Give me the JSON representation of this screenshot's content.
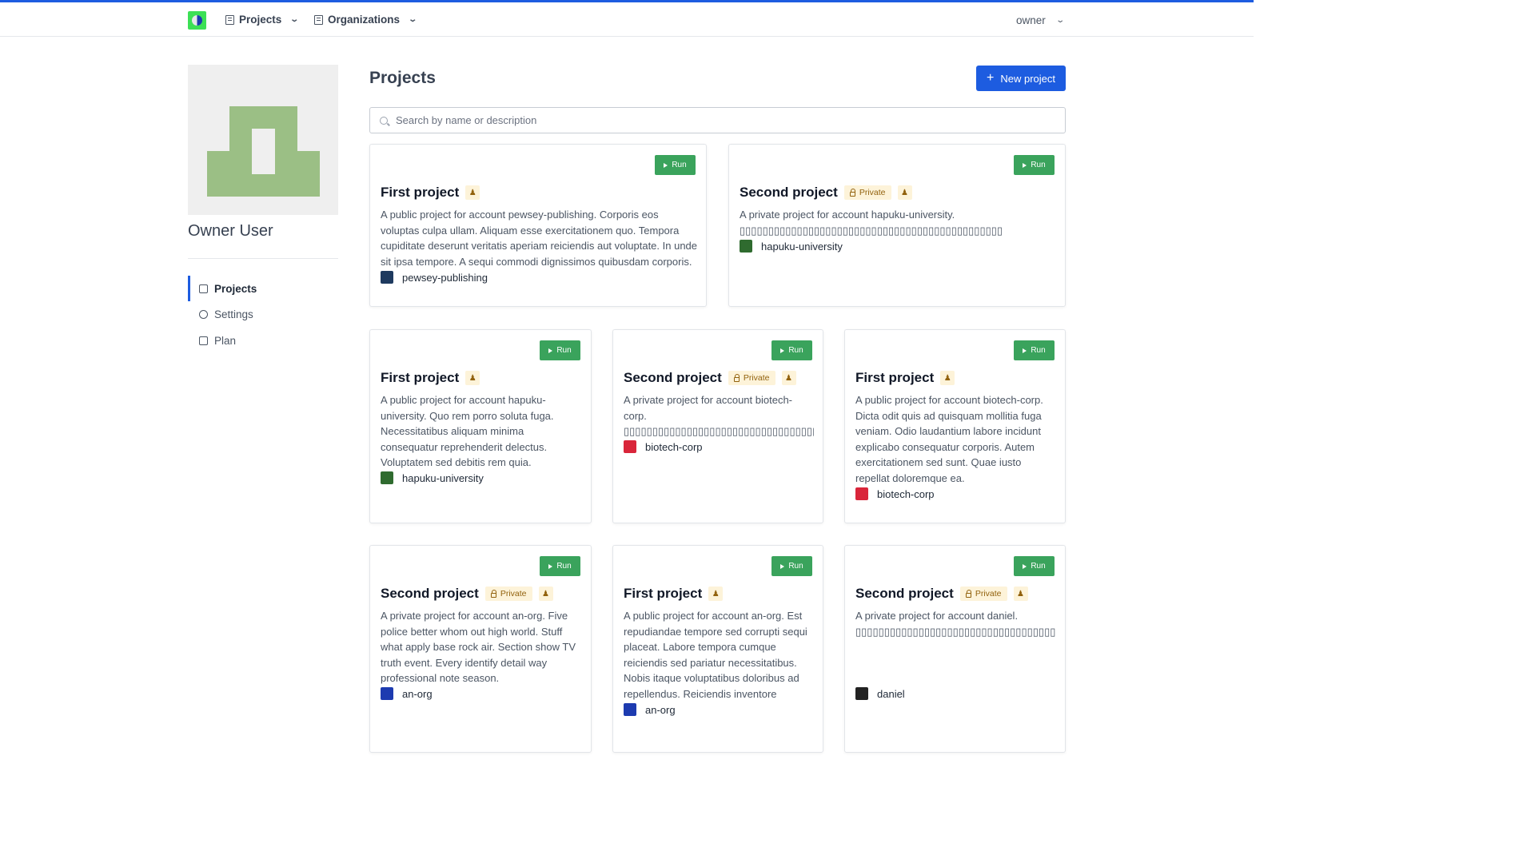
{
  "topbar": {
    "projects_label": "Projects",
    "organizations_label": "Organizations",
    "user_label": "owner"
  },
  "sidebar": {
    "owner_name": "Owner User",
    "items": [
      {
        "label": "Projects"
      },
      {
        "label": "Settings"
      },
      {
        "label": "Plan"
      }
    ]
  },
  "main": {
    "title": "Projects",
    "new_project_label": "New project",
    "search_placeholder": "Search by name or description",
    "run_label": "Run",
    "private_label": "Private",
    "cards": [
      {
        "title": "First project",
        "private": false,
        "description": "A public project for account pewsey-publishing. Corporis eos voluptas culpa ullam. Aliquam esse exercitationem quo. Tempora cupiditate deserunt veritatis aperiam reiciendis aut voluptate. In unde sit ipsa tempore. A sequi commodi dignissimos quibusdam corporis.",
        "owner": "pewsey-publishing",
        "owner_color": "#1e3a5f"
      },
      {
        "title": "Second project",
        "private": true,
        "description": "A private project for account hapuku-university. ▯▯▯▯▯▯▯▯▯▯▯▯▯▯▯▯▯▯▯▯▯▯▯▯▯▯▯▯▯▯▯▯▯▯▯▯▯▯▯▯▯▯▯▯▯▯",
        "owner": "hapuku-university",
        "owner_color": "#2f6b2f"
      },
      {
        "title": "First project",
        "private": false,
        "description": "A public project for account hapuku-university. Quo rem porro soluta fuga. Necessitatibus aliquam minima consequatur reprehenderit delectus. Voluptatem sed debitis rem quia.",
        "owner": "hapuku-university",
        "owner_color": "#2f6b2f"
      },
      {
        "title": "Second project",
        "private": true,
        "description": "A private project for account biotech-corp. ▯▯▯▯▯▯▯▯▯▯▯▯▯▯▯▯▯▯▯▯▯▯▯▯▯▯▯▯▯▯▯▯▯▯▯▯▯▯▯▯▯▯",
        "owner": "biotech-corp",
        "owner_color": "#d9253a"
      },
      {
        "title": "First project",
        "private": false,
        "description": "A public project for account biotech-corp. Dicta odit quis ad quisquam mollitia fuga veniam. Odio laudantium labore incidunt explicabo consequatur corporis. Autem exercitationem sed sunt. Quae iusto repellat doloremque ea.",
        "owner": "biotech-corp",
        "owner_color": "#d9253a"
      },
      {
        "title": "Second project",
        "private": true,
        "description": "A private project for account an-org. Five police better whom out high world. Stuff what apply base rock air. Section show TV truth event. Every identify detail way professional note season.",
        "owner": "an-org",
        "owner_color": "#1d3bb0"
      },
      {
        "title": "First project",
        "private": false,
        "description": "A public project for account an-org. Est repudiandae tempore sed corrupti sequi placeat. Labore tempora cumque reiciendis sed pariatur necessitatibus. Nobis itaque voluptatibus doloribus ad repellendus. Reiciendis inventore ducimus",
        "owner": "an-org",
        "owner_color": "#1d3bb0"
      },
      {
        "title": "Second project",
        "private": true,
        "description": "A private project for account daniel. ▯▯▯▯▯▯▯▯▯▯▯▯▯▯▯▯▯▯▯▯▯▯▯▯▯▯▯▯▯▯▯▯▯▯▯▯▯▯▯▯▯▯▯▯▯▯▯▯▯▯▯▯▯▯▯▯▯▯▯▯▯▯▯▯▯▯▯▯▯▯▯▯▯▯▯▯▯▯▯▯▯▯▯▯▯▯▯▯▯▯▯",
        "owner": "daniel",
        "owner_color": "#222222"
      }
    ]
  },
  "colors": {
    "accent": "#1d5ce0",
    "run": "#3aa35c",
    "private_badge_bg": "#fdf3d9",
    "avatar_shape": "#9bbf85"
  }
}
